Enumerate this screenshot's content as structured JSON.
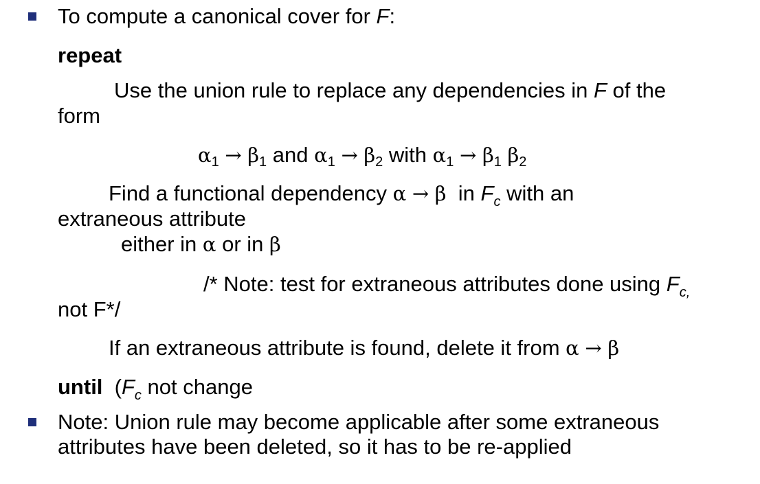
{
  "bullet1": {
    "text": "To compute a canonical cover for ",
    "var": "F",
    "colon": ":"
  },
  "repeat_kw": "repeat",
  "union": {
    "line1_pre": "Use the union rule to replace any dependencies in ",
    "var": "F",
    "line1_post": " of the",
    "line2": "form"
  },
  "formula": {
    "alpha": "α",
    "beta": "β",
    "arrow": "→",
    "sub1": "1",
    "sub2": "2",
    "and": " and ",
    "with": " with "
  },
  "find": {
    "pre": "Find a functional dependency ",
    "in": "  in ",
    "fvar": "F",
    "fsub": "c",
    "post": " with an",
    "line2": "extraneous attribute",
    "line3_pre": "either in ",
    "or_in": " or in "
  },
  "note_comment": {
    "pre": "/* Note: test for extraneous attributes done using ",
    "fvar": "F",
    "fsub": "c,",
    "line2": "not F*/"
  },
  "if_line": {
    "text": "If an extraneous attribute is found, delete it from "
  },
  "until": {
    "kw": "until",
    "text1": "  (",
    "fvar": "F",
    "fsub": "c",
    "text2": " not change"
  },
  "bullet2": {
    "line1": "Note: Union rule may become applicable after some extraneous",
    "line2": "attributes have been deleted, so it has to be re-applied"
  }
}
